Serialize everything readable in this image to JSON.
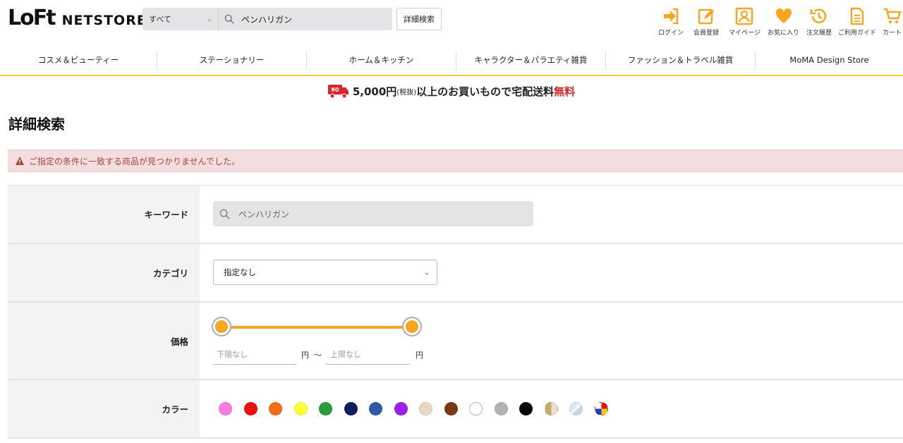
{
  "header": {
    "logo_main": "LoFt",
    "logo_sub": "NETSTORE",
    "search_scope": "すべて",
    "search_value": "ペンハリガン",
    "advanced_search_label": "詳細検索",
    "utility": [
      {
        "label": "ログイン",
        "icon": "login-icon"
      },
      {
        "label": "会員登録",
        "icon": "register-icon"
      },
      {
        "label": "マイページ",
        "icon": "mypage-icon"
      },
      {
        "label": "お気に入り",
        "icon": "heart-icon"
      },
      {
        "label": "注文履歴",
        "icon": "history-icon"
      },
      {
        "label": "ご利用ガイド",
        "icon": "guide-icon"
      },
      {
        "label": "カート",
        "icon": "cart-icon"
      }
    ],
    "accent_color": "#f6a623"
  },
  "nav": [
    "コスメ＆ビューティー",
    "ステーショナリー",
    "ホーム＆キッチン",
    "キャラクター＆パラエティ雑貨",
    "ファッション＆トラベル雑貨",
    "MoMA Design Store"
  ],
  "banner": {
    "badge": "¥0",
    "amount": "5,000円",
    "tax": "(税抜)",
    "text": "以上のお買いもので宅配送料",
    "free": "無料"
  },
  "page_title": "詳細検索",
  "alert": {
    "message": "ご指定の条件に一致する商品が見つかりませんでした。",
    "color": "#a94442"
  },
  "form": {
    "keyword": {
      "label": "キーワード",
      "value": "ペンハリガン"
    },
    "category": {
      "label": "カテゴリ",
      "selected": "指定なし"
    },
    "price": {
      "label": "価格",
      "min_placeholder": "下限なし",
      "max_placeholder": "上限なし",
      "unit": "円",
      "separator": "〜",
      "range_fraction": [
        0,
        1
      ]
    },
    "color": {
      "label": "カラー",
      "swatches": [
        "#f77ee0",
        "#ee0f0f",
        "#f36c1a",
        "#ffff3a",
        "#279e3b",
        "#0c1f5c",
        "#2e5aa5",
        "#9b1ff2",
        "#e8d8c3",
        "#7d3a12",
        "#ffffff",
        "#b3b3b3",
        "#050505",
        "gold-split",
        "silver-clear",
        "multi"
      ]
    }
  }
}
